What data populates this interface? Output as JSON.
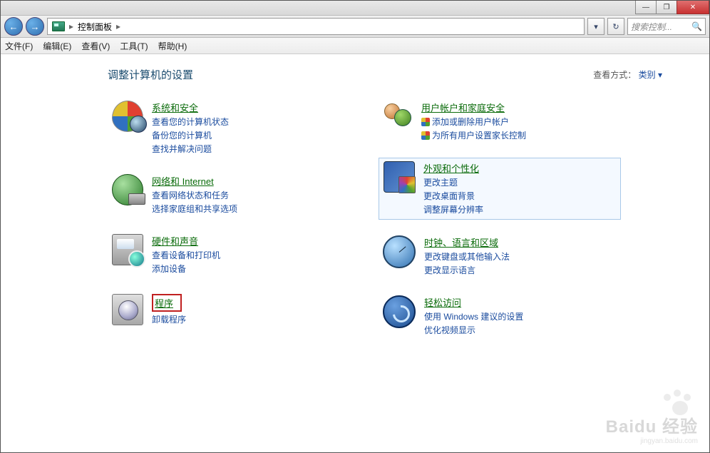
{
  "window_controls": {
    "min": "—",
    "max": "❐",
    "close": "✕"
  },
  "nav": {
    "back": "←",
    "forward": "→",
    "refresh": "↻",
    "dropdown": "▾"
  },
  "address": {
    "location": "控制面板",
    "sep": "▸"
  },
  "search": {
    "placeholder": "搜索控制...",
    "icon": "🔍"
  },
  "menu": {
    "file": "文件(F)",
    "edit": "编辑(E)",
    "view": "查看(V)",
    "tools": "工具(T)",
    "help": "帮助(H)"
  },
  "page_title": "调整计算机的设置",
  "view_by": {
    "label": "查看方式：",
    "value": "类别",
    "arrow": "▾"
  },
  "categories": {
    "system": {
      "title": "系统和安全",
      "links": [
        "查看您的计算机状态",
        "备份您的计算机",
        "查找并解决问题"
      ]
    },
    "network": {
      "title": "网络和 Internet",
      "links": [
        "查看网络状态和任务",
        "选择家庭组和共享选项"
      ]
    },
    "hardware": {
      "title": "硬件和声音",
      "links": [
        "查看设备和打印机",
        "添加设备"
      ]
    },
    "programs": {
      "title": "程序",
      "links": [
        "卸载程序"
      ]
    },
    "accounts": {
      "title": "用户帐户和家庭安全",
      "links": [
        "添加或删除用户帐户",
        "为所有用户设置家长控制"
      ],
      "shields": [
        true,
        true
      ]
    },
    "appearance": {
      "title": "外观和个性化",
      "links": [
        "更改主题",
        "更改桌面背景",
        "调整屏幕分辨率"
      ]
    },
    "clock": {
      "title": "时钟、语言和区域",
      "links": [
        "更改键盘或其他输入法",
        "更改显示语言"
      ]
    },
    "ease": {
      "title": "轻松访问",
      "links": [
        "使用 Windows 建议的设置",
        "优化视频显示"
      ]
    }
  },
  "watermark": {
    "brand": "Baidu 经验",
    "url": "jingyan.baidu.com"
  }
}
